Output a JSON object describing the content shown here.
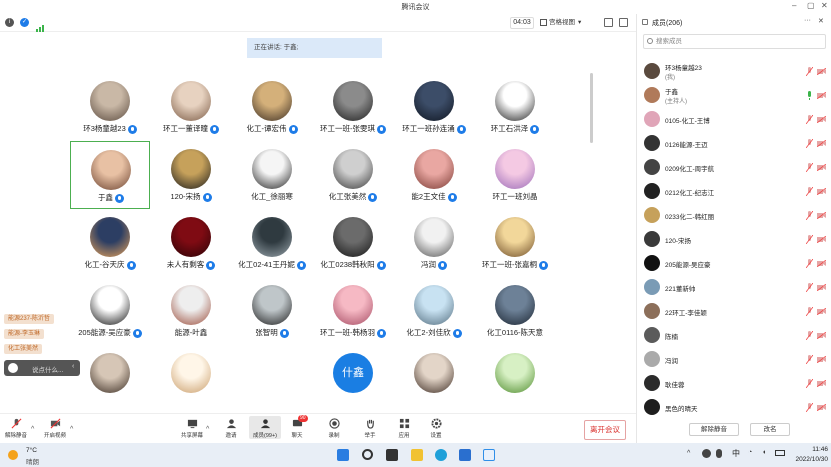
{
  "window": {
    "title": "腾讯会议"
  },
  "info": {
    "timer": "04:03",
    "view_mode": "宫格视图"
  },
  "speaking": {
    "text": "正在讲话: 于鑫;"
  },
  "participants_grid": [
    {
      "name": "环3杨童越23",
      "mic": true,
      "colors": [
        "#c9b8a6",
        "#5a4a3e"
      ]
    },
    {
      "name": "环工一董译曈",
      "mic": true,
      "colors": [
        "#e7d2c0",
        "#7a5a44"
      ]
    },
    {
      "name": "化工-谭宏伟",
      "mic": true,
      "colors": [
        "#d4b07a",
        "#3b2d22"
      ]
    },
    {
      "name": "环工一班-张雯琪",
      "mic": true,
      "colors": [
        "#8b8b8b",
        "#1d1d1d"
      ]
    },
    {
      "name": "环工一班孙连涌",
      "mic": true,
      "colors": [
        "#3c4d68",
        "#0f1520"
      ]
    },
    {
      "name": "环工石洪泽",
      "mic": true,
      "colors": [
        "#ffffff",
        "#222222"
      ]
    },
    {
      "name": "于鑫",
      "mic": true,
      "active": true,
      "colors": [
        "#e8c1a4",
        "#6b4230"
      ]
    },
    {
      "name": "120-宋扬",
      "mic": true,
      "colors": [
        "#c6a15b",
        "#1b1b1b"
      ]
    },
    {
      "name": "化工_徐丽寒",
      "mic": false,
      "colors": [
        "#f5f5f5",
        "#222222"
      ]
    },
    {
      "name": "化工张美然",
      "mic": true,
      "colors": [
        "#cfcfcf",
        "#3a3a3a"
      ]
    },
    {
      "name": "能2王文佳",
      "mic": true,
      "colors": [
        "#e9a7a2",
        "#7b3b34"
      ]
    },
    {
      "name": "环工一班刘晶",
      "mic": false,
      "colors": [
        "#f4c9e3",
        "#9b6bb8"
      ]
    },
    {
      "name": "化工-谷天庆",
      "mic": true,
      "colors": [
        "#2c3e63",
        "#e8a35a"
      ]
    },
    {
      "name": "未人有剩客",
      "mic": true,
      "colors": [
        "#7f0b13",
        "#2a0306"
      ]
    },
    {
      "name": "化工02-41王丹妮",
      "mic": true,
      "colors": [
        "#2f3a40",
        "#9aa6ad"
      ]
    },
    {
      "name": "化工0238韩秋阳",
      "mic": true,
      "colors": [
        "#6b6b6b",
        "#151515"
      ]
    },
    {
      "name": "冯润",
      "mic": true,
      "colors": [
        "#f1f1f1",
        "#555555"
      ]
    },
    {
      "name": "环工一班-张嘉桐",
      "mic": true,
      "colors": [
        "#f2d79a",
        "#6f4d28"
      ]
    },
    {
      "name": "205能源-吴应豪",
      "mic": true,
      "colors": [
        "#ffffff",
        "#111111"
      ]
    },
    {
      "name": "能源-叶鑫",
      "mic": false,
      "colors": [
        "#eeeeee",
        "#9b4c3a"
      ]
    },
    {
      "name": "张智明",
      "mic": true,
      "colors": [
        "#bfc6c9",
        "#1c1c1c"
      ]
    },
    {
      "name": "环工一班-韩杨羽",
      "mic": true,
      "colors": [
        "#f6b9c4",
        "#a44a62"
      ]
    },
    {
      "name": "化工2-刘佳欣",
      "mic": true,
      "colors": [
        "#c8e2f2",
        "#536d7e"
      ]
    },
    {
      "name": "化工0116-陈天意",
      "mic": false,
      "colors": [
        "#6d8197",
        "#1b2531"
      ]
    },
    {
      "name": "",
      "mic": false,
      "colors": [
        "#d6c6b6",
        "#3a2c22"
      ]
    },
    {
      "name": "",
      "mic": false,
      "colors": [
        "#fff6e8",
        "#c99d6a"
      ]
    },
    {
      "name": "",
      "mic": false,
      "colors": [
        "#ffffff",
        "#ffffff"
      ]
    },
    {
      "name": "",
      "mic": false,
      "colors": [
        "#1a7ee3",
        "#1a7ee3"
      ],
      "glyph": "什鑫"
    },
    {
      "name": "",
      "mic": false,
      "colors": [
        "#e3d5c8",
        "#3c2b22"
      ]
    },
    {
      "name": "",
      "mic": false,
      "colors": [
        "#d7f0c4",
        "#4f8c2d"
      ]
    }
  ],
  "toasts": [
    "能源237-陈沂哲",
    "能源-李玉琳",
    "化工张美然"
  ],
  "chat": {
    "placeholder": "说点什么..."
  },
  "toolbar": {
    "mute": "解除静音",
    "video": "开启视频",
    "share": "共享屏幕",
    "invite": "邀请",
    "members": "成员(99+)",
    "chat": "聊天",
    "chat_badge": "90",
    "record": "录制",
    "raise": "举手",
    "apps": "应用",
    "settings": "设置",
    "leave": "离开会议"
  },
  "panel": {
    "header": "成员(206)",
    "search_placeholder": "搜索成员",
    "members": [
      {
        "name": "环3杨童越23",
        "sub": "(我)",
        "color": "#5a4a3e"
      },
      {
        "name": "于鑫",
        "sub": "(主持人)",
        "color": "#b07a5a",
        "mic_on": true
      },
      {
        "name": "0105-化工-王博",
        "color": "#e0a5b8"
      },
      {
        "name": "0126能源-王迈",
        "color": "#333333"
      },
      {
        "name": "0209化工-周宇航",
        "color": "#444444"
      },
      {
        "name": "0212化工-纪志江",
        "color": "#222222"
      },
      {
        "name": "0233化二-韩红丽",
        "color": "#c6a15b"
      },
      {
        "name": "120-宋扬",
        "color": "#3a3a3a"
      },
      {
        "name": "205能源-吴应豪",
        "color": "#111111"
      },
      {
        "name": "221董新帅",
        "color": "#7a9bb5"
      },
      {
        "name": "22环工-李佳颖",
        "color": "#8c6f5a"
      },
      {
        "name": "陈楠",
        "color": "#5b5b5b"
      },
      {
        "name": "冯润",
        "color": "#aaaaaa"
      },
      {
        "name": "耿佳蓉",
        "color": "#2b2b2b"
      },
      {
        "name": "黑色的晴天",
        "color": "#1e1e1e"
      }
    ],
    "unmute_all": "解除静音",
    "rename": "改名"
  },
  "taskbar": {
    "weather_temp": "7°C",
    "weather_text": "晴朗",
    "ime": "中",
    "time": "11:46",
    "date": "2022/10/30"
  }
}
